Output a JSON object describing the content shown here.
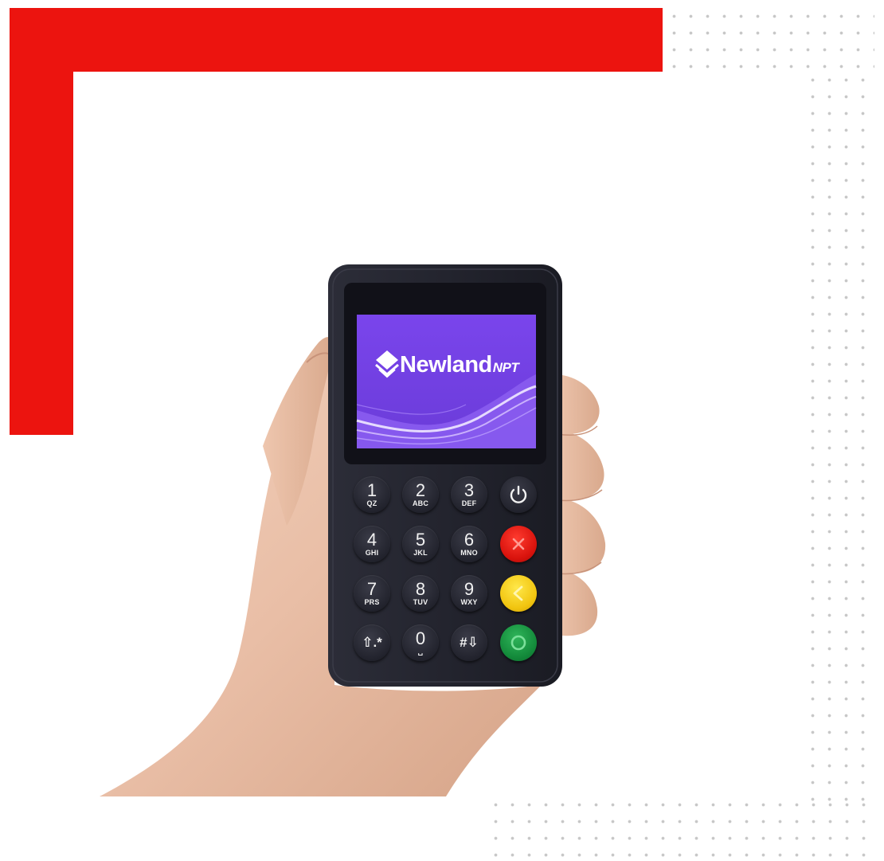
{
  "colors": {
    "accent_red": "#ec140f",
    "dot_grey": "#c7c7c7",
    "device_body": "#22232d",
    "screen_purple": "#7b4be8",
    "key_red": "#d8120c",
    "key_yellow": "#f1c40f",
    "key_green": "#13893a"
  },
  "screen": {
    "brand_name": "Newland",
    "brand_suffix": "NPT"
  },
  "keypad": {
    "keys": [
      {
        "digit": "1",
        "letters": "QZ"
      },
      {
        "digit": "2",
        "letters": "ABC"
      },
      {
        "digit": "3",
        "letters": "DEF"
      },
      {
        "digit": "4",
        "letters": "GHI"
      },
      {
        "digit": "5",
        "letters": "JKL"
      },
      {
        "digit": "6",
        "letters": "MNO"
      },
      {
        "digit": "7",
        "letters": "PRS"
      },
      {
        "digit": "8",
        "letters": "TUV"
      },
      {
        "digit": "9",
        "letters": "WXY"
      }
    ],
    "bottom": {
      "shift_star": "⇧.*",
      "zero": "0",
      "zero_sub": "␣",
      "hash_down": "#⇩"
    },
    "function_keys": [
      "power-icon",
      "cancel-icon",
      "back-icon",
      "confirm-icon"
    ]
  }
}
